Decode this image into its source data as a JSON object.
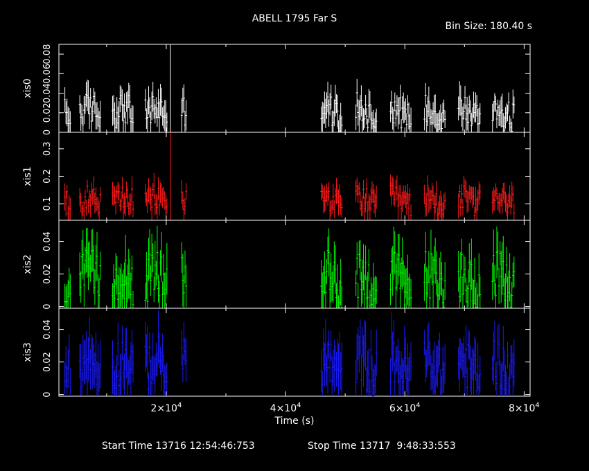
{
  "header": {
    "title": "ABELL 1795 Far S",
    "bin_size": "Bin Size: 180.40 s"
  },
  "footer": {
    "start_time": "Start Time 13716 12:54:46:753",
    "stop_time": "Stop Time 13717  9:48:33:553"
  },
  "chart_data": {
    "type": "line",
    "xlabel": "Time (s)",
    "xlim": [
      2000,
      81000
    ],
    "x_ticks": [
      {
        "value": 20000,
        "mantissa": "2×10",
        "exp": "4"
      },
      {
        "value": 40000,
        "mantissa": "4×10",
        "exp": "4"
      },
      {
        "value": 60000,
        "mantissa": "6×10",
        "exp": "4"
      },
      {
        "value": 80000,
        "mantissa": "8×10",
        "exp": "4"
      }
    ],
    "segments": [
      {
        "start": 3000,
        "end": 4000
      },
      {
        "start": 5500,
        "end": 9000
      },
      {
        "start": 11000,
        "end": 14500
      },
      {
        "start": 16500,
        "end": 20200
      },
      {
        "start": 22600,
        "end": 23400
      },
      {
        "start": 46000,
        "end": 49600
      },
      {
        "start": 51800,
        "end": 55400
      },
      {
        "start": 57600,
        "end": 61200
      },
      {
        "start": 63300,
        "end": 66900
      },
      {
        "start": 69000,
        "end": 72700
      },
      {
        "start": 74700,
        "end": 78400
      }
    ],
    "panels": [
      {
        "name": "xis0",
        "color": "#ffffff",
        "ylim": [
          0,
          0.09
        ],
        "base": 0.02,
        "amp": 0.016,
        "ticks": [
          0,
          0.02,
          0.04,
          0.06,
          0.08
        ],
        "tick_labels": [
          "0",
          "0.02",
          "0.04",
          "0.06",
          "0.08"
        ],
        "spike": {
          "x": 20700,
          "y": 0.09
        }
      },
      {
        "name": "xis1",
        "color": "#ff1a1a",
        "ylim": [
          0.04,
          0.36
        ],
        "base": 0.11,
        "amp": 0.045,
        "ticks": [
          0.1,
          0.2,
          0.3
        ],
        "tick_labels": [
          "0.1",
          "0.2",
          "0.3"
        ],
        "spike": {
          "x": 20700,
          "y": 0.36
        }
      },
      {
        "name": "xis2",
        "color": "#00ff00",
        "ylim": [
          -0.001,
          0.053
        ],
        "base": 0.016,
        "amp": 0.015,
        "ticks": [
          0,
          0.02,
          0.04
        ],
        "tick_labels": [
          "0",
          "0.02",
          "0.04"
        ],
        "spike": null
      },
      {
        "name": "xis3",
        "color": "#1a1aff",
        "ylim": [
          -0.001,
          0.053
        ],
        "base": 0.017,
        "amp": 0.015,
        "ticks": [
          0,
          0.02,
          0.04
        ],
        "tick_labels": [
          "0",
          "0.02",
          "0.04"
        ],
        "spike": null
      }
    ]
  }
}
